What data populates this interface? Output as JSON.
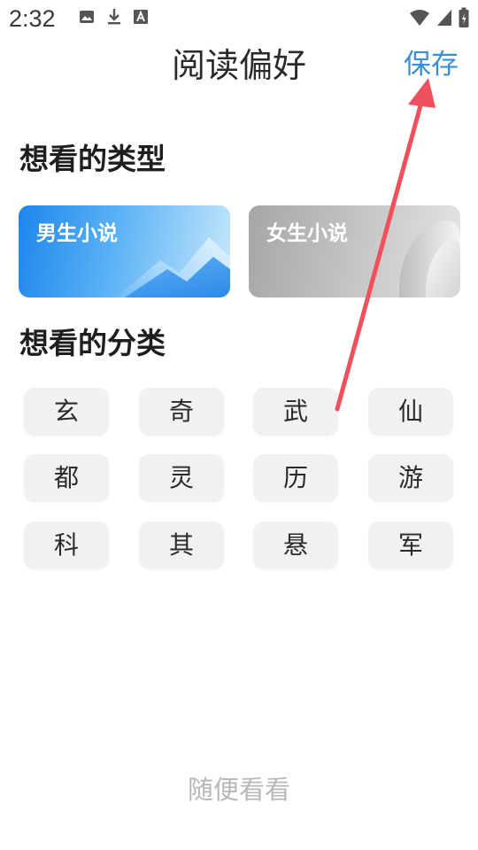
{
  "status_bar": {
    "time": "2:32",
    "left_icons": [
      "image-icon",
      "download-icon",
      "text-a-icon"
    ],
    "right_icons": [
      "wifi-icon",
      "signal-icon",
      "battery-icon"
    ]
  },
  "header": {
    "title": "阅读偏好",
    "save_label": "保存",
    "accent_color": "#3b8ed8"
  },
  "type_section": {
    "title": "想看的类型",
    "cards": [
      {
        "label": "男生小说"
      },
      {
        "label": "女生小说"
      }
    ]
  },
  "category_section": {
    "title": "想看的分类",
    "items": [
      "玄",
      "奇",
      "武",
      "仙",
      "都",
      "灵",
      "历",
      "游",
      "科",
      "其",
      "悬",
      "军"
    ]
  },
  "footer": {
    "random_label": "随便看看"
  },
  "annotation": {
    "arrow_color": "#f0505c"
  }
}
